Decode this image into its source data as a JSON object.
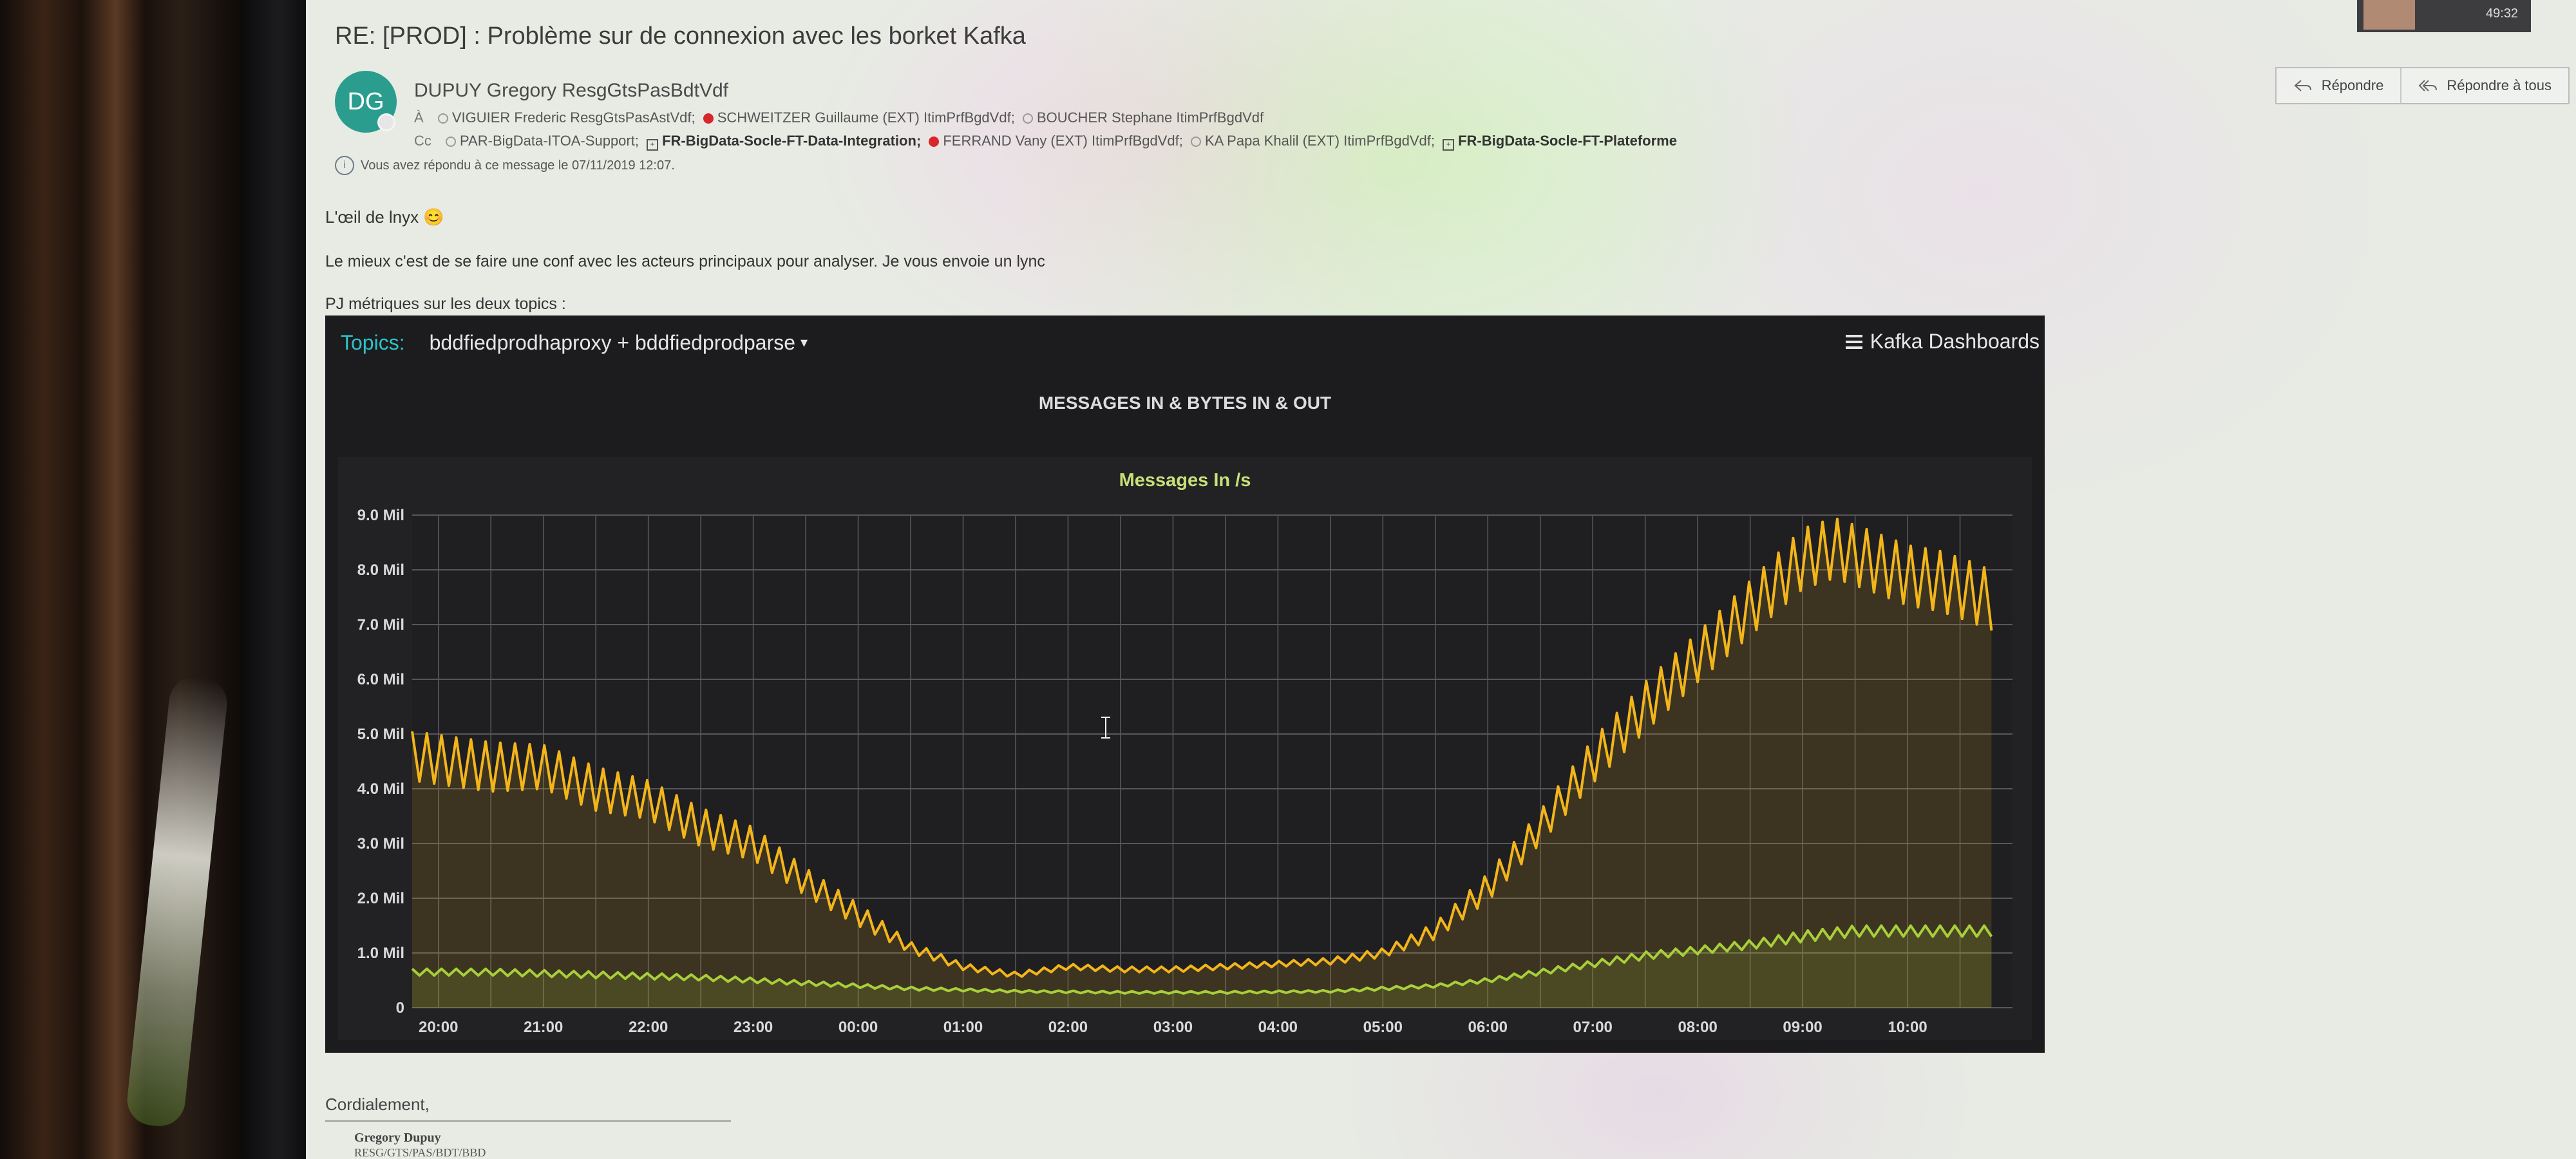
{
  "email": {
    "subject": "RE: [PROD] : Problème sur de connexion avec les borket Kafka",
    "avatar_initials": "DG",
    "sender": "DUPUY Gregory ResgGtsPasBdtVdf",
    "to_label": "À",
    "to": [
      {
        "name": "VIGUIER Frederic ResgGtsPasAstVdf;",
        "status": "grey"
      },
      {
        "name": "SCHWEITZER Guillaume (EXT) ItimPrfBgdVdf;",
        "status": "red"
      },
      {
        "name": "BOUCHER Stephane ItimPrfBgdVdf",
        "status": "grey"
      }
    ],
    "cc_label": "Cc",
    "cc": [
      {
        "name": "PAR-BigData-ITOA-Support;",
        "status": "grey",
        "bold": false
      },
      {
        "name": "FR-BigData-Socle-FT-Data-Integration;",
        "status": "group",
        "bold": true
      },
      {
        "name": "FERRAND Vany (EXT) ItimPrfBgdVdf;",
        "status": "red",
        "bold": false
      },
      {
        "name": "KA Papa Khalil (EXT) ItimPrfBgdVdf;",
        "status": "grey",
        "bold": false
      },
      {
        "name": "FR-BigData-Socle-FT-Plateforme",
        "status": "group",
        "bold": true
      }
    ],
    "replied_notice": "Vous avez répondu à ce message le 07/11/2019 12:07.",
    "body_line1": "L'œil de lnyx 😊",
    "body_line2": "Le mieux c'est de se faire une conf avec les acteurs principaux pour analyser. Je vous envoie un lync",
    "body_line3": "PJ métriques sur les deux topics :",
    "signoff": "Cordialement,",
    "signature_name": "Gregory Dupuy",
    "signature_org": "RESG/GTS/PAS/BDT/BBD"
  },
  "toolbar": {
    "reply_label": "Répondre",
    "reply_all_label": "Répondre à tous"
  },
  "corner": {
    "time": "49:32"
  },
  "dashboard": {
    "topics_label": "Topics:",
    "topics_value": "bddfiedprodhaproxy + bddfiedprodparse",
    "menu_label": "Kafka Dashboards",
    "panel_title": "MESSAGES IN & BYTES IN & OUT",
    "chart_title": "Messages In /s"
  },
  "chart_data": {
    "type": "line",
    "title": "Messages In /s",
    "xlabel": "",
    "ylabel": "",
    "y_ticks": [
      "0",
      "1.0 Mil",
      "2.0 Mil",
      "3.0 Mil",
      "4.0 Mil",
      "5.0 Mil",
      "6.0 Mil",
      "7.0 Mil",
      "8.0 Mil",
      "9.0 Mil"
    ],
    "ylim": [
      0,
      9.0
    ],
    "y_unit": "Mil",
    "x_ticks": [
      "20:00",
      "21:00",
      "22:00",
      "23:00",
      "00:00",
      "01:00",
      "02:00",
      "03:00",
      "04:00",
      "05:00",
      "06:00",
      "07:00",
      "08:00",
      "09:00",
      "10:00"
    ],
    "x_tick_hours": [
      20,
      21,
      22,
      23,
      24,
      25,
      26,
      27,
      28,
      29,
      30,
      31,
      32,
      33,
      34
    ],
    "xlim": [
      19.75,
      35.0
    ],
    "grid": true,
    "series": [
      {
        "color": "#f3b51a",
        "x": [
          19.75,
          20.5,
          21.0,
          21.5,
          22.0,
          22.5,
          23.0,
          23.5,
          24.0,
          24.5,
          25.0,
          25.5,
          26.0,
          26.5,
          27.0,
          27.5,
          28.0,
          28.5,
          29.0,
          29.5,
          30.0,
          30.5,
          31.0,
          31.5,
          32.0,
          32.5,
          33.0,
          33.3,
          33.6,
          34.0,
          34.3,
          34.6,
          34.85
        ],
        "values": [
          4.6,
          4.4,
          4.4,
          4.0,
          3.8,
          3.3,
          3.0,
          2.3,
          1.7,
          1.1,
          0.75,
          0.6,
          0.75,
          0.7,
          0.7,
          0.75,
          0.8,
          0.85,
          1.0,
          1.4,
          2.2,
          3.3,
          4.5,
          5.5,
          6.4,
          7.3,
          8.2,
          8.4,
          8.2,
          7.9,
          7.8,
          7.6,
          7.4
        ],
        "amplitude": [
          0.45,
          0.45,
          0.4,
          0.4,
          0.35,
          0.35,
          0.3,
          0.25,
          0.2,
          0.1,
          0.06,
          0.05,
          0.05,
          0.05,
          0.05,
          0.05,
          0.05,
          0.06,
          0.08,
          0.15,
          0.25,
          0.3,
          0.4,
          0.45,
          0.45,
          0.5,
          0.55,
          0.55,
          0.55,
          0.55,
          0.55,
          0.55,
          0.55
        ]
      },
      {
        "color": "#a8cf3a",
        "x": [
          19.75,
          20.5,
          21.5,
          22.5,
          23.5,
          24.5,
          25.5,
          26.5,
          27.5,
          28.5,
          29.0,
          29.5,
          30.0,
          30.5,
          31.0,
          31.5,
          32.0,
          32.5,
          33.0,
          33.5,
          34.0,
          34.5,
          34.85
        ],
        "values": [
          0.65,
          0.65,
          0.6,
          0.55,
          0.45,
          0.35,
          0.3,
          0.28,
          0.28,
          0.3,
          0.35,
          0.4,
          0.5,
          0.65,
          0.8,
          0.95,
          1.05,
          1.15,
          1.3,
          1.4,
          1.4,
          1.4,
          1.4
        ],
        "amplitude": [
          0.06,
          0.06,
          0.06,
          0.05,
          0.04,
          0.03,
          0.02,
          0.02,
          0.02,
          0.02,
          0.03,
          0.03,
          0.04,
          0.05,
          0.06,
          0.07,
          0.07,
          0.08,
          0.1,
          0.1,
          0.1,
          0.1,
          0.1
        ]
      }
    ]
  }
}
